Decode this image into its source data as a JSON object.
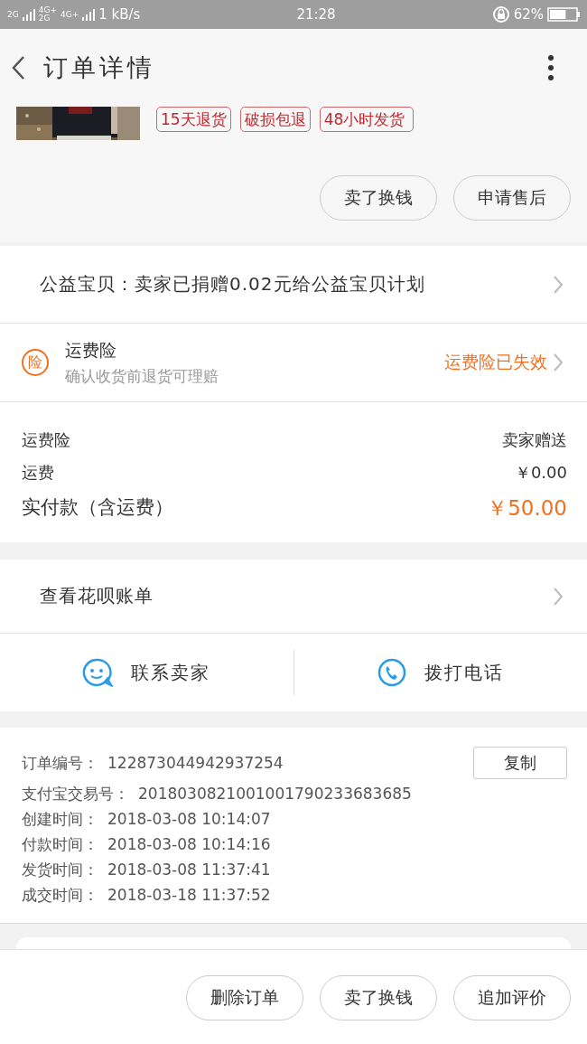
{
  "status_bar": {
    "network_1": "2G",
    "network_2": "4G+",
    "network_3": "4G+",
    "network_4": "2G",
    "speed": "1 kB/s",
    "time": "21:28",
    "battery": "62%"
  },
  "header": {
    "title": "订单详情"
  },
  "product": {
    "tags": [
      "15天退货",
      "破损包退",
      "48小时发货"
    ]
  },
  "product_actions": [
    "卖了换钱",
    "申请售后"
  ],
  "charity": {
    "text": "公益宝贝：卖家已捐赠0.02元给公益宝贝计划"
  },
  "insurance": {
    "badge": "险",
    "title": "运费险",
    "subtitle": "确认收货前退货可理赔",
    "status": "运费险已失效"
  },
  "fees": [
    {
      "label": "运费险",
      "value": "卖家赠送",
      "kind": "normal"
    },
    {
      "label": "运费",
      "value": "￥0.00",
      "kind": "normal"
    },
    {
      "label": "实付款（含运费）",
      "value": "￥50.00",
      "kind": "total"
    }
  ],
  "huabei": {
    "text": "查看花呗账单"
  },
  "contact": [
    {
      "label": "联系卖家",
      "kind": "chat"
    },
    {
      "label": "拨打电话",
      "kind": "phone"
    }
  ],
  "order_info": {
    "copy_button": "复制",
    "lines": [
      {
        "label": "订单编号：",
        "value": "122873044942937254"
      },
      {
        "label": "支付宝交易号：",
        "value": "2018030821001001790233683685"
      },
      {
        "label": "创建时间：",
        "value": "2018-03-08 10:14:07"
      },
      {
        "label": "付款时间：",
        "value": "2018-03-08 10:14:16"
      },
      {
        "label": "发货时间：",
        "value": "2018-03-08 11:37:41"
      },
      {
        "label": "成交时间：",
        "value": "2018-03-18 11:37:52"
      }
    ]
  },
  "bottom_actions": [
    "删除订单",
    "卖了换钱",
    "追加评价"
  ]
}
